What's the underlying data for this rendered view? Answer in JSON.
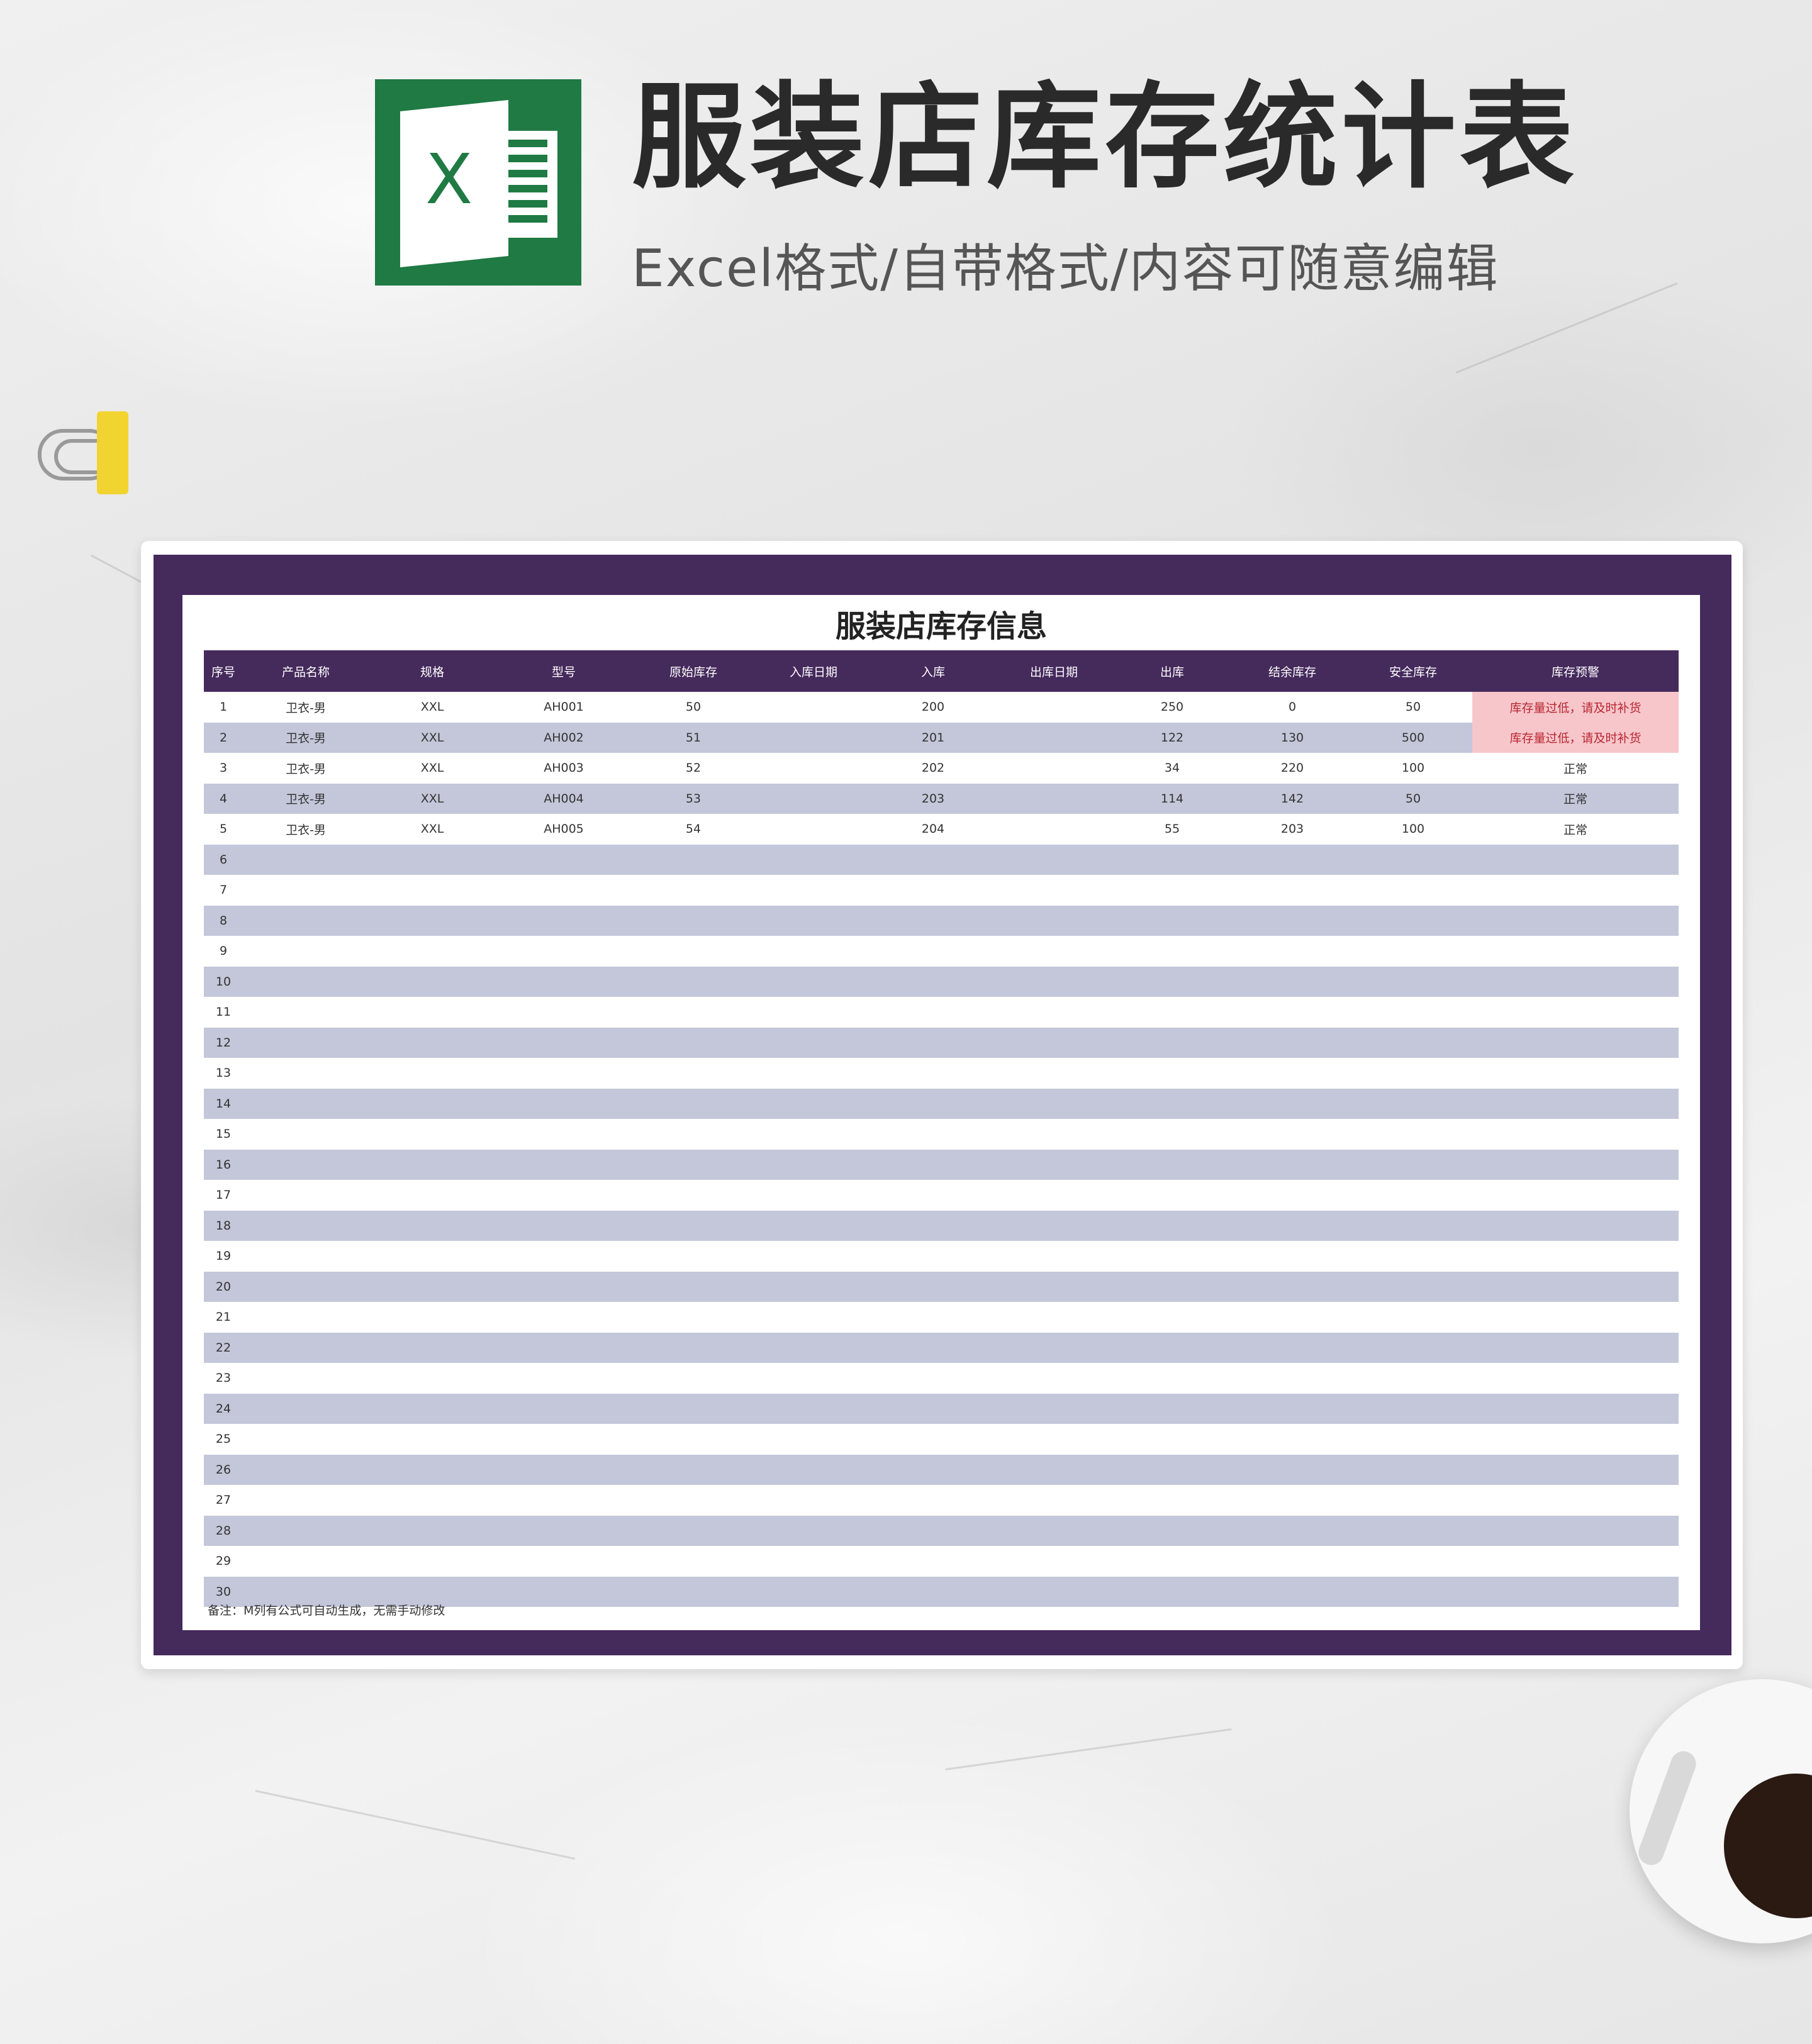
{
  "header": {
    "title": "服装店库存统计表",
    "subtitle": "Excel格式/自带格式/内容可随意编辑",
    "logo_letter": "X"
  },
  "sheet": {
    "title": "服装店库存信息",
    "columns": [
      "序号",
      "产品名称",
      "规格",
      "型号",
      "原始库存",
      "入库日期",
      "入库",
      "出库日期",
      "出库",
      "结余库存",
      "安全库存",
      "库存预警"
    ],
    "rows": [
      [
        "1",
        "卫衣-男",
        "XXL",
        "AH001",
        "50",
        "",
        "200",
        "",
        "250",
        "0",
        "50",
        "库存量过低，请及时补货"
      ],
      [
        "2",
        "卫衣-男",
        "XXL",
        "AH002",
        "51",
        "",
        "201",
        "",
        "122",
        "130",
        "500",
        "库存量过低，请及时补货"
      ],
      [
        "3",
        "卫衣-男",
        "XXL",
        "AH003",
        "52",
        "",
        "202",
        "",
        "34",
        "220",
        "100",
        "正常"
      ],
      [
        "4",
        "卫衣-男",
        "XXL",
        "AH004",
        "53",
        "",
        "203",
        "",
        "114",
        "142",
        "50",
        "正常"
      ],
      [
        "5",
        "卫衣-男",
        "XXL",
        "AH005",
        "54",
        "",
        "204",
        "",
        "55",
        "203",
        "100",
        "正常"
      ],
      [
        "6",
        "",
        "",
        "",
        "",
        "",
        "",
        "",
        "",
        "",
        "",
        ""
      ],
      [
        "7",
        "",
        "",
        "",
        "",
        "",
        "",
        "",
        "",
        "",
        "",
        ""
      ],
      [
        "8",
        "",
        "",
        "",
        "",
        "",
        "",
        "",
        "",
        "",
        "",
        ""
      ],
      [
        "9",
        "",
        "",
        "",
        "",
        "",
        "",
        "",
        "",
        "",
        "",
        ""
      ],
      [
        "10",
        "",
        "",
        "",
        "",
        "",
        "",
        "",
        "",
        "",
        "",
        ""
      ],
      [
        "11",
        "",
        "",
        "",
        "",
        "",
        "",
        "",
        "",
        "",
        "",
        ""
      ],
      [
        "12",
        "",
        "",
        "",
        "",
        "",
        "",
        "",
        "",
        "",
        "",
        ""
      ],
      [
        "13",
        "",
        "",
        "",
        "",
        "",
        "",
        "",
        "",
        "",
        "",
        ""
      ],
      [
        "14",
        "",
        "",
        "",
        "",
        "",
        "",
        "",
        "",
        "",
        "",
        ""
      ],
      [
        "15",
        "",
        "",
        "",
        "",
        "",
        "",
        "",
        "",
        "",
        "",
        ""
      ],
      [
        "16",
        "",
        "",
        "",
        "",
        "",
        "",
        "",
        "",
        "",
        "",
        ""
      ],
      [
        "17",
        "",
        "",
        "",
        "",
        "",
        "",
        "",
        "",
        "",
        "",
        ""
      ],
      [
        "18",
        "",
        "",
        "",
        "",
        "",
        "",
        "",
        "",
        "",
        "",
        ""
      ],
      [
        "19",
        "",
        "",
        "",
        "",
        "",
        "",
        "",
        "",
        "",
        "",
        ""
      ],
      [
        "20",
        "",
        "",
        "",
        "",
        "",
        "",
        "",
        "",
        "",
        "",
        ""
      ],
      [
        "21",
        "",
        "",
        "",
        "",
        "",
        "",
        "",
        "",
        "",
        "",
        ""
      ],
      [
        "22",
        "",
        "",
        "",
        "",
        "",
        "",
        "",
        "",
        "",
        "",
        ""
      ],
      [
        "23",
        "",
        "",
        "",
        "",
        "",
        "",
        "",
        "",
        "",
        "",
        ""
      ],
      [
        "24",
        "",
        "",
        "",
        "",
        "",
        "",
        "",
        "",
        "",
        "",
        ""
      ],
      [
        "25",
        "",
        "",
        "",
        "",
        "",
        "",
        "",
        "",
        "",
        "",
        ""
      ],
      [
        "26",
        "",
        "",
        "",
        "",
        "",
        "",
        "",
        "",
        "",
        "",
        ""
      ],
      [
        "27",
        "",
        "",
        "",
        "",
        "",
        "",
        "",
        "",
        "",
        "",
        ""
      ],
      [
        "28",
        "",
        "",
        "",
        "",
        "",
        "",
        "",
        "",
        "",
        "",
        ""
      ],
      [
        "29",
        "",
        "",
        "",
        "",
        "",
        "",
        "",
        "",
        "",
        "",
        ""
      ],
      [
        "30",
        "",
        "",
        "",
        "",
        "",
        "",
        "",
        "",
        "",
        "",
        ""
      ]
    ],
    "warn_text": "库存量过低，请及时补货",
    "note": "备注：M列有公式可自动生成，无需手动修改"
  },
  "colors": {
    "frame_purple": "#452a5c",
    "stripe": "#c3c7d9",
    "warn_bg": "#f7c6cb",
    "warn_text": "#b8262f",
    "excel_green": "#1f7a43"
  }
}
